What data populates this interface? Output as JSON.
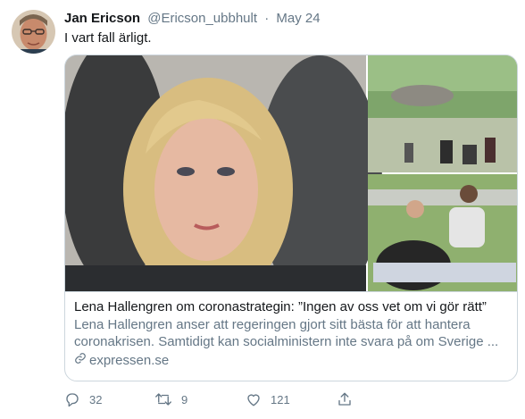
{
  "tweet": {
    "author_name": "Jan Ericson",
    "handle": "@Ericson_ubbhult",
    "separator": "·",
    "date": "May 24",
    "text": "I vart fall ärligt."
  },
  "card": {
    "title": "Lena Hallengren om coronastrategin: ”Ingen av oss vet om vi gör rätt”",
    "description": "Lena Hallengren anser att regeringen gjort sitt bästa för att hantera coronakrisen. Samtidigt kan socialministern inte svara på om Sverige ...",
    "domain": "expressen.se"
  },
  "actions": {
    "replies": "32",
    "retweets": "9",
    "likes": "121"
  },
  "icons": [
    "reply-icon",
    "retweet-icon",
    "like-icon",
    "share-icon",
    "link-icon"
  ],
  "colors": {
    "text": "#14171a",
    "secondary": "#657786",
    "border": "#ccd6dd"
  }
}
